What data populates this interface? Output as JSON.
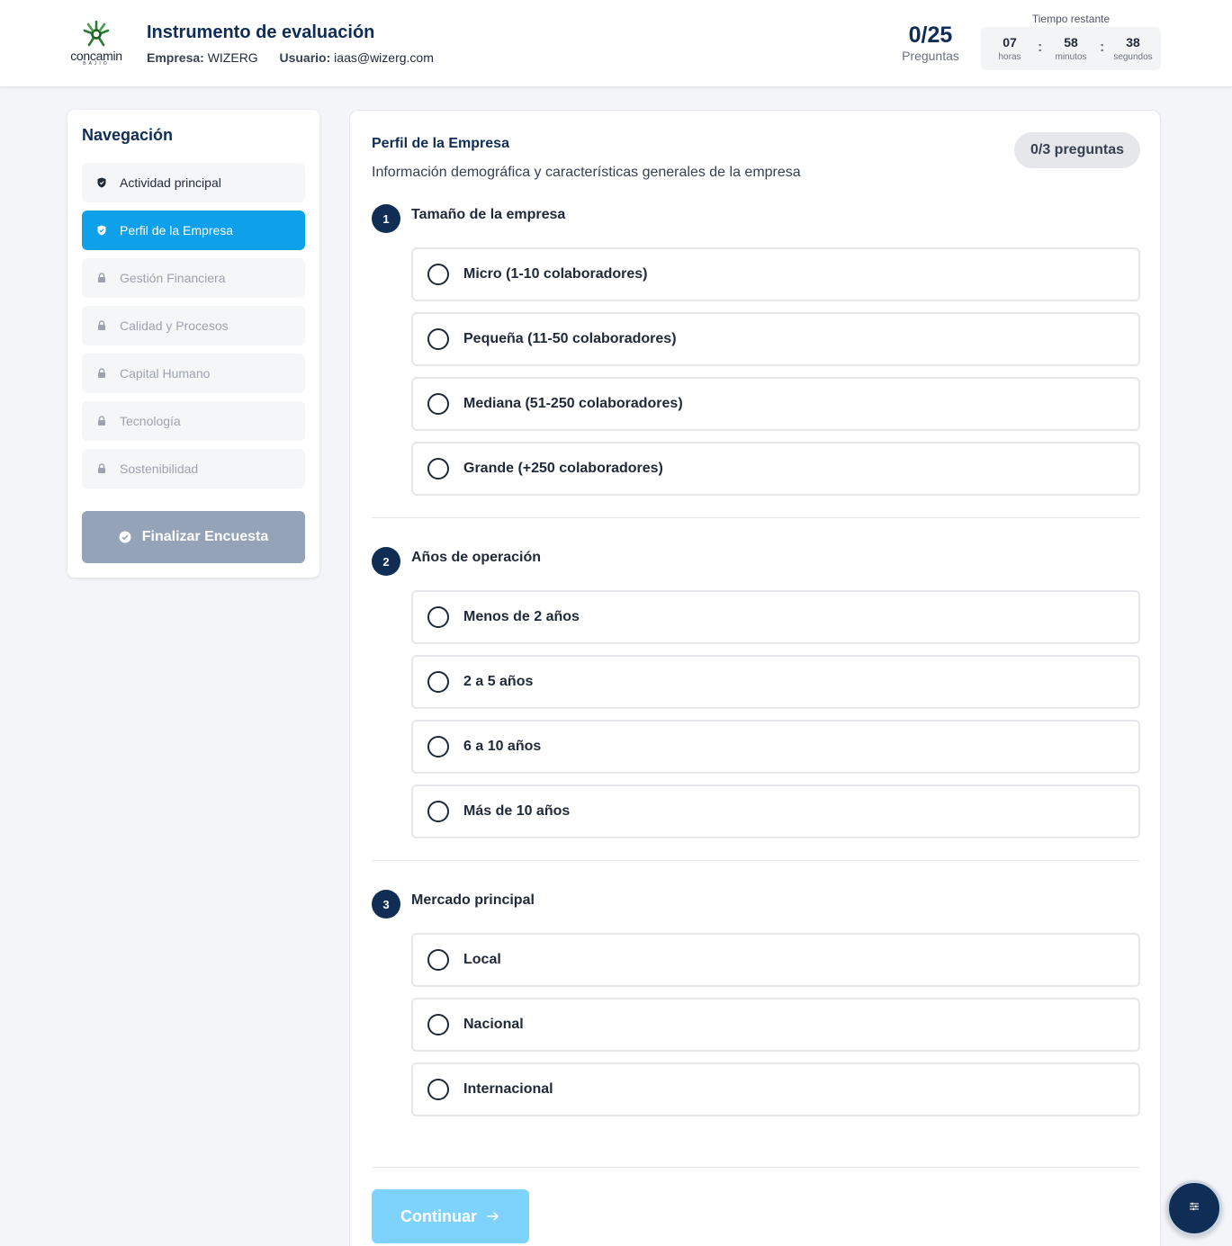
{
  "header": {
    "logo_text": "concamin",
    "logo_sub": "BAJIO",
    "title": "Instrumento de evaluación",
    "company_label": "Empresa:",
    "company_value": "WIZERG",
    "user_label": "Usuario:",
    "user_value": "iaas@wizerg.com",
    "progress_value": "0/25",
    "progress_label": "Preguntas",
    "timer": {
      "label": "Tiempo restante",
      "hours": "07",
      "hours_label": "horas",
      "minutes": "58",
      "minutes_label": "minutos",
      "seconds": "38",
      "seconds_label": "segundos",
      "separator": ":"
    }
  },
  "sidebar": {
    "title": "Navegación",
    "items": [
      {
        "label": "Actividad principal",
        "state": "completed",
        "icon": "shield-check-icon"
      },
      {
        "label": "Perfil de la Empresa",
        "state": "active",
        "icon": "shield-check-icon"
      },
      {
        "label": "Gestión Financiera",
        "state": "locked",
        "icon": "lock-icon"
      },
      {
        "label": "Calidad y Procesos",
        "state": "locked",
        "icon": "lock-icon"
      },
      {
        "label": "Capital Humano",
        "state": "locked",
        "icon": "lock-icon"
      },
      {
        "label": "Tecnología",
        "state": "locked",
        "icon": "lock-icon"
      },
      {
        "label": "Sostenibilidad",
        "state": "locked",
        "icon": "lock-icon"
      }
    ],
    "finalize_label": "Finalizar Encuesta"
  },
  "section": {
    "title": "Perfil de la Empresa",
    "description": "Información demográfica y características generales de la empresa",
    "badge": "0/3 preguntas",
    "questions": [
      {
        "number": "1",
        "text": "Tamaño de la empresa",
        "options": [
          "Micro (1-10 colaboradores)",
          "Pequeña (11-50 colaboradores)",
          "Mediana (51-250 colaboradores)",
          "Grande (+250 colaboradores)"
        ]
      },
      {
        "number": "2",
        "text": "Años de operación",
        "options": [
          "Menos de 2 años",
          "2 a 5 años",
          "6 a 10 años",
          "Más de 10 años"
        ]
      },
      {
        "number": "3",
        "text": "Mercado principal",
        "options": [
          "Local",
          "Nacional",
          "Internacional"
        ]
      }
    ],
    "continue_label": "Continuar"
  },
  "colors": {
    "primary_navy": "#0f2d55",
    "active_blue": "#0ea0e9",
    "continue_disabled": "#7dd3fc",
    "finalize_disabled": "#94a3b8"
  }
}
